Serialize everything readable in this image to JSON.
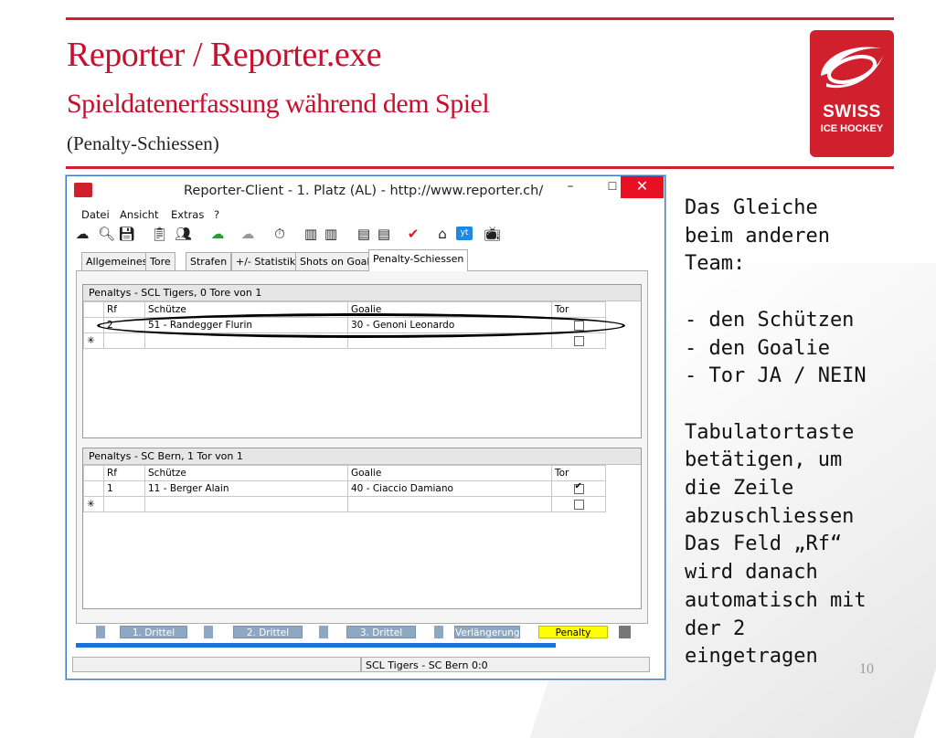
{
  "slide": {
    "title": "Reporter / Reporter.exe",
    "subtitle": "Spieldatenerfassung während dem Spiel",
    "subsubtitle": "(Penalty-Schiessen)",
    "page_number": "10",
    "accent_color": "#d0202e"
  },
  "logo": {
    "line1": "SWISS",
    "line2": "ICE HOCKEY"
  },
  "window": {
    "title": "Reporter-Client  -  1. Platz (AL)  -  http://www.reporter.ch/",
    "controls": {
      "minimize": "–",
      "maximize": "☐",
      "close": "✕"
    },
    "menu": [
      "Datei",
      "Ansicht",
      "Extras",
      "?"
    ],
    "toolbar_icons": [
      "cloud-download-icon",
      "search-icon",
      "save-icon",
      "clipboard-icon",
      "players-icon",
      "cloud-upload-icon",
      "cloud-delete-icon",
      "stopwatch-icon",
      "lineup-icon",
      "lineup2-icon",
      "lineup3-icon",
      "lineup4-icon",
      "checkmark-icon",
      "home-icon",
      "youtube-icon",
      "tv-icon"
    ],
    "tabs": [
      "Allgemeines",
      "Tore",
      "Strafen",
      "+/- Statistik",
      "Shots on Goal",
      "Penalty-Schiessen"
    ],
    "active_tab": "Penalty-Schiessen"
  },
  "panels": [
    {
      "header": "Penaltys - SCL Tigers, 0 Tore von 1",
      "columns": [
        "Rf",
        "Schütze",
        "Goalie",
        "Tor"
      ],
      "rows": [
        {
          "marker": "",
          "rf": "2",
          "shooter": "51 - Randegger Flurin",
          "goalie": "30 - Genoni Leonardo",
          "goal": false
        }
      ],
      "new_row_marker": "✳"
    },
    {
      "header": "Penaltys - SC Bern, 1 Tor von 1",
      "columns": [
        "Rf",
        "Schütze",
        "Goalie",
        "Tor"
      ],
      "rows": [
        {
          "marker": "",
          "rf": "1",
          "shooter": "11 - Berger Alain",
          "goalie": "40 - Ciaccio Damiano",
          "goal": true
        }
      ],
      "new_row_marker": "✳"
    }
  ],
  "periods": [
    "1. Drittel",
    "2. Drittel",
    "3. Drittel",
    "Verlängerung",
    "Penalty"
  ],
  "active_period": "Penalty",
  "statusbar": {
    "score": "SCL Tigers - SC Bern 0:0"
  },
  "note": {
    "lines": [
      "Das Gleiche",
      "beim anderen",
      "Team:",
      "",
      "- den Schützen",
      "- den Goalie",
      "- Tor JA / NEIN",
      "",
      "Tabulatortaste",
      "betätigen, um",
      "die Zeile",
      "abzuschliessen",
      "Das Feld „Rf“",
      "wird danach",
      "automatisch mit",
      "der 2",
      "eingetragen"
    ]
  }
}
